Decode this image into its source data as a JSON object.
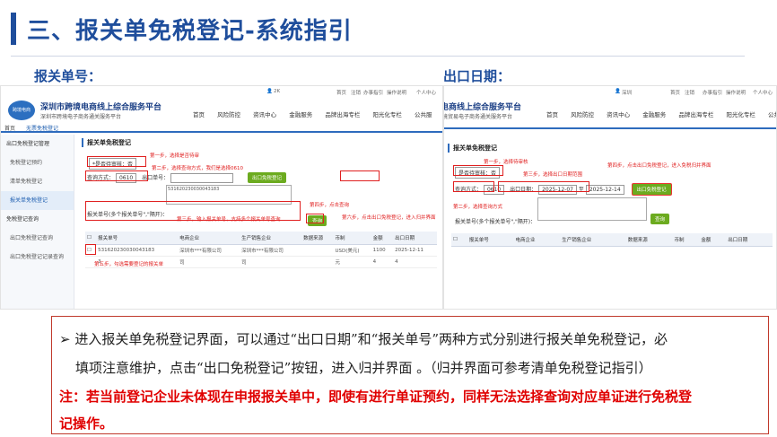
{
  "slide": {
    "title": "三、报关单免税登记-系统指引",
    "left_label": "报关单号：",
    "right_label": "出口日期："
  },
  "left_screen": {
    "topbar": [
      "2K",
      "首页",
      "注销",
      "办事指引",
      "操作说明",
      "个人中心"
    ],
    "logo_text": "跨境电商",
    "portal_name": "深圳市跨境电商线上综合服务平台",
    "portal_sub": "深圳市跨境电子商务通关服务平台",
    "nav": [
      "首页",
      "风险防控",
      "资讯中心",
      "金融服务",
      "品牌出海专栏",
      "阳光化专栏",
      "公共服"
    ],
    "crumb_home": "首页",
    "crumb_current": "无票免税登记",
    "sidebar": [
      {
        "label": "出口免税登记管理",
        "active": false,
        "sub": false
      },
      {
        "label": "免税登记预约",
        "active": false,
        "sub": true
      },
      {
        "label": "清单免税登记",
        "active": false,
        "sub": true
      },
      {
        "label": "报关单免税登记",
        "active": true,
        "sub": true
      },
      {
        "label": "免税登记查询",
        "active": false,
        "sub": false
      },
      {
        "label": "出口免税登记查询",
        "active": false,
        "sub": true
      },
      {
        "label": "出口免税登记记录查询",
        "active": false,
        "sub": true
      }
    ],
    "page_head": "报关单免税登记",
    "tax_type_select": "*是否待审核：否",
    "query_method_label": "查询方式：",
    "query_method_value": "0610",
    "declaration_no_label": "出口单号：",
    "declaration_no_value": "531620230030043183",
    "sample_text": "531620230030043183",
    "multi_label": "报关单号(多个报关单号\",\"隔开)：",
    "export_btn": "出口免税登记",
    "query_btn": "查询",
    "annotations": {
      "step1": "第一步，选择是否待审",
      "step2": "第二步，选择查询方式，我们是选择0610",
      "step3": "第三步，输入报关单号，支持多个报关单号查询",
      "step4": "第四步，点击查询",
      "step5": "第五步，勾选需要登记的报关单",
      "step6": "第六步，点击出口免税登记，进入归并界面"
    },
    "table_headers": [
      "报关单号",
      "电商企业",
      "生产销售企业",
      "数据来源",
      "币制",
      "金额",
      "出口日期"
    ],
    "table_row": [
      "531620230030043183",
      "深圳市***有限公司",
      "深圳市***有限公司",
      "",
      "USD(美元)",
      "1100",
      "2025-12-11"
    ],
    "table_row2": [
      "3",
      "司",
      "司",
      "",
      "元",
      "4",
      "4"
    ]
  },
  "right_screen": {
    "topbar": [
      "深圳",
      "首页",
      "注销",
      "办事指引",
      "操作说明",
      "个人中心"
    ],
    "portal_name": "电商线上综合服务平台",
    "portal_sub": "境贸易电子商务通关服务平台",
    "nav": [
      "首页",
      "风险防控",
      "资讯中心",
      "金融服务",
      "品牌出海专栏",
      "阳光化专栏",
      "公共服务"
    ],
    "page_head": "报关单免税登记",
    "tax_type_select": "是否待审核：否",
    "query_method_label": "查询方式：",
    "query_method_value": "0610",
    "date_label": "出口日期：",
    "date_from": "2025-12-07",
    "date_to": "至",
    "date_to_value": "2025-12-14",
    "export_btn": "出口免税登记",
    "query_btn": "查询",
    "multi_label": "报关单号(多个报关单号\",\"隔开)：",
    "annotations": {
      "step1": "第一步，选择待审核",
      "step2": "第二步，选择查询方式",
      "step3": "第三步，选择出口日期范围",
      "step4": "第四步，点击出口免税登记，进入免税归并界面"
    },
    "table_headers": [
      "报关单号",
      "电商企业",
      "生产销售企业",
      "数据来源",
      "币制",
      "金额",
      "出口日期"
    ]
  },
  "note": {
    "line1": "➢ 进入报关单免税登记界面，可以通过“出口日期”和“报关单号”两种方式分别进行报关单免税登记，必",
    "line2": "填项注意维护，点击“出口免税登记”按钮，进入归并界面 。（归并界面可参考清单免税登记指引）",
    "red1": "注：若当前登记企业未体现在申报报关单中，即使有进行单证预约，同样无法选择查询对应单证进行免税登",
    "red2": "记操作。"
  },
  "colors": {
    "title_blue": "#1f4e9c",
    "button_green": "#6cab1f",
    "annotation_red": "#e02020",
    "note_red": "#e00000"
  }
}
